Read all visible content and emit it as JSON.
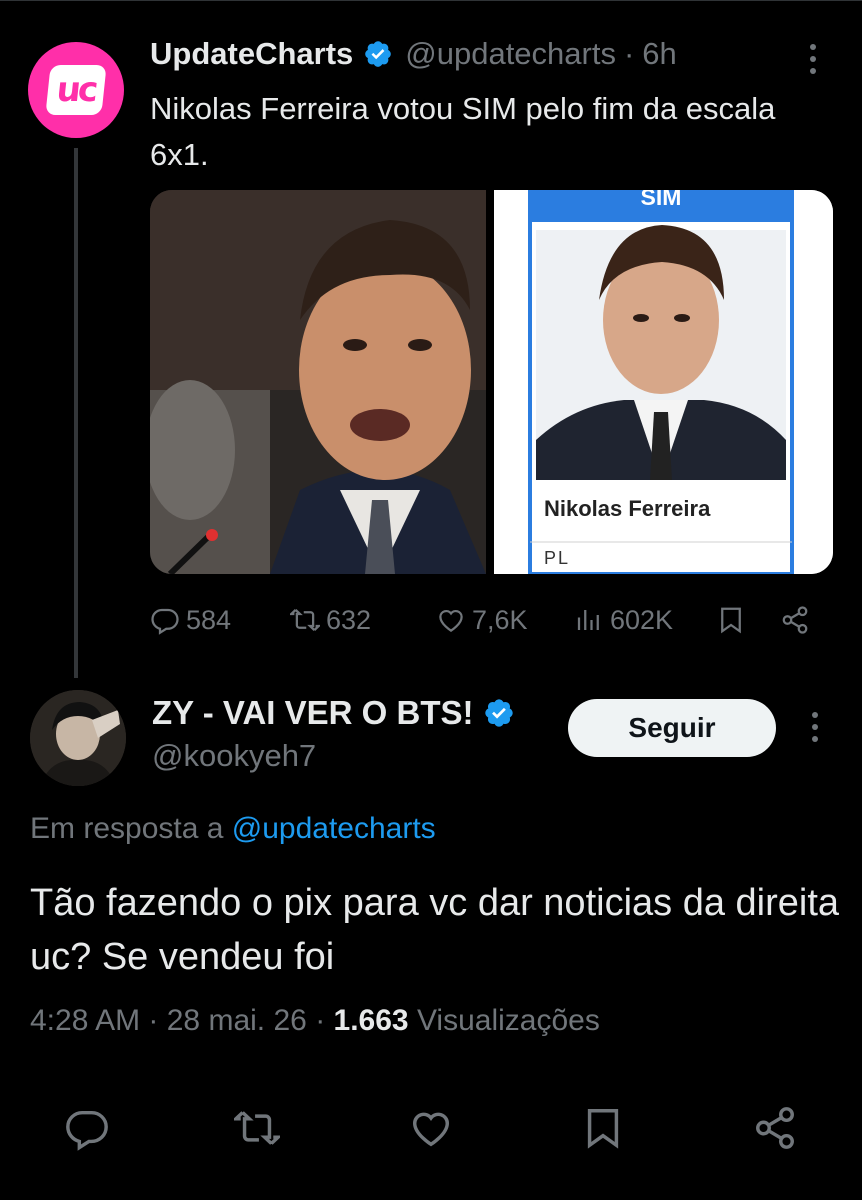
{
  "parent_tweet": {
    "display_name": "UpdateCharts",
    "handle": "@updatecharts",
    "separator": "·",
    "time": "6h",
    "text": "Nikolas Ferreira votou SIM pelo fim da escala 6x1.",
    "avatar_letters": "uc",
    "media": {
      "right_card_header": "SIM",
      "right_card_name": "Nikolas Ferreira",
      "right_card_party": "PL"
    },
    "stats": {
      "replies": "584",
      "reposts": "632",
      "likes": "7,6K",
      "views": "602K"
    }
  },
  "reply_tweet": {
    "display_name": "ZY - VAI VER O BTS!",
    "handle": "@kookyeh7",
    "follow_label": "Seguir",
    "reply_prefix": "Em resposta a",
    "reply_mention": "@updatecharts",
    "text": "Tão fazendo o pix para vc dar noticias da direita uc? Se vendeu foi",
    "time": "4:28 AM",
    "date": "28 mai. 26",
    "views_count": "1.663",
    "views_label": "Visualizações"
  },
  "colors": {
    "background": "#000000",
    "text_primary": "#e7e9ea",
    "text_secondary": "#71767b",
    "accent_blue": "#1d9bf0",
    "brand_pink": "#ff2fa9",
    "verified_blue": "#1d9bf0"
  },
  "icons": [
    "reply-icon",
    "repost-icon",
    "like-icon",
    "views-icon",
    "bookmark-icon",
    "share-icon",
    "verified-icon",
    "more-icon"
  ]
}
